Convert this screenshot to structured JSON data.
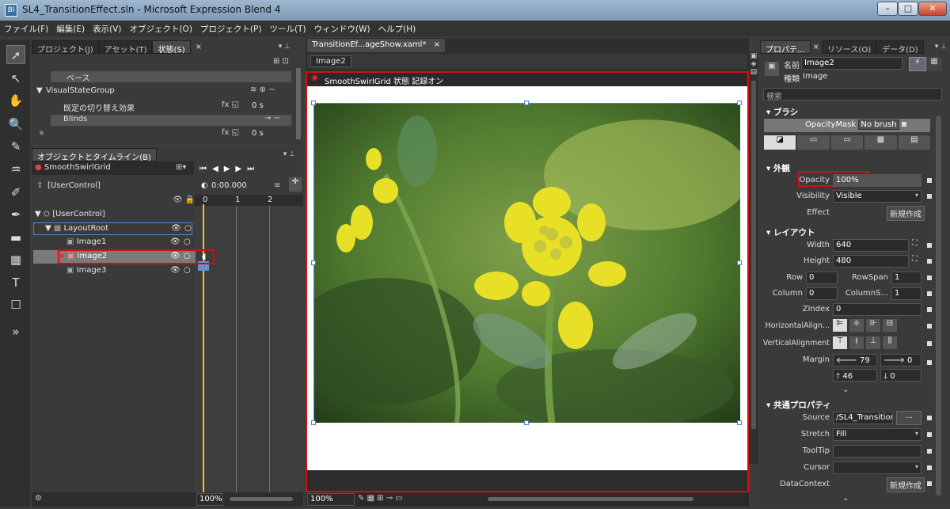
{
  "window": {
    "title": "SL4_TransitionEffect.sln - Microsoft Expression Blend 4",
    "app_icon": "Bl"
  },
  "menu": [
    "ファイル(F)",
    "編集(E)",
    "表示(V)",
    "オブジェクト(O)",
    "プロジェクト(P)",
    "ツール(T)",
    "ウィンドウ(W)",
    "ヘルプ(H)"
  ],
  "states_panel": {
    "tabs": [
      "プロジェクト(J)",
      "アセット(T)",
      "状態(S)"
    ],
    "base": "ベース",
    "group": "VisualStateGroup",
    "default_transition": "既定の切り替え効果",
    "default_time": "0 s",
    "state": "Blinds",
    "state_time": "0 s"
  },
  "objects_panel": {
    "title": "オブジェクトとタイムライン(B)",
    "storyboard": "SmoothSwirlGrid",
    "root": "[UserControl]",
    "tree": [
      "[UserControl]",
      "LayoutRoot",
      "Image1",
      "Image2",
      "Image3"
    ],
    "time": "0:00.000",
    "ticks": [
      "0",
      "1",
      "2"
    ],
    "zoom": "100%"
  },
  "document": {
    "tab": "TransitionEf...ageShow.xaml*",
    "breadcrumb": "Image2",
    "recording": "SmoothSwirlGrid 状態 記録オン",
    "zoom": "100%"
  },
  "properties": {
    "tabs": [
      "プロパテ...",
      "リソース(O)",
      "データ(D)"
    ],
    "name_label": "名前",
    "name_value": "Image2",
    "type_label": "種類",
    "type_value": "Image",
    "search": "検索",
    "brush_section": "ブラシ",
    "opacity_mask": "OpacityMask",
    "no_brush": "No brush",
    "appearance_section": "外観",
    "opacity_label": "Opacity",
    "opacity_value": "100%",
    "visibility_label": "Visibility",
    "visibility_value": "Visible",
    "effect_label": "Effect",
    "new_button": "新規作成",
    "layout_section": "レイアウト",
    "width_label": "Width",
    "width_value": "640",
    "height_label": "Height",
    "height_value": "480",
    "row_label": "Row",
    "row_value": "0",
    "rowspan_label": "RowSpan",
    "rowspan_value": "1",
    "column_label": "Column",
    "column_value": "0",
    "columnspan_label": "ColumnS...",
    "columnspan_value": "1",
    "zindex_label": "ZIndex",
    "zindex_value": "0",
    "halign_label": "HorizontalAlign...",
    "valign_label": "VerticalAlignment",
    "margin_label": "Margin",
    "margin_left": "79",
    "margin_right": "0",
    "margin_top": "46",
    "margin_bottom": "0",
    "common_section": "共通プロパティ",
    "source_label": "Source",
    "source_value": "/SL4_Transition",
    "stretch_label": "Stretch",
    "stretch_value": "Fill",
    "tooltip_label": "ToolTip",
    "cursor_label": "Cursor",
    "datacontext_label": "DataContext",
    "new_button2": "新規作成",
    "browse": "..."
  }
}
